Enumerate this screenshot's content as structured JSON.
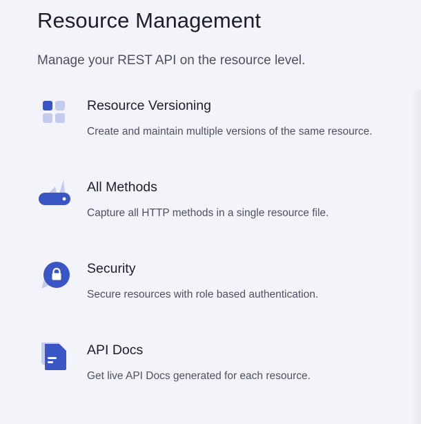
{
  "header": {
    "title": "Resource Management",
    "subtitle": "Manage your REST API on the resource level."
  },
  "colors": {
    "accent": "#3a55c4",
    "accent_light": "#c3cbee",
    "background": "#f3f4f9"
  },
  "features": [
    {
      "icon": "grid-blocks-icon",
      "title": "Resource Versioning",
      "description": "Create and maintain multiple versions of the same resource."
    },
    {
      "icon": "swiss-knife-icon",
      "title": "All Methods",
      "description": "Capture all HTTP methods in a single resource file."
    },
    {
      "icon": "lock-chat-icon",
      "title": "Security",
      "description": "Secure resources with role based authentication."
    },
    {
      "icon": "document-icon",
      "title": "API Docs",
      "description": "Get live API Docs generated for each resource."
    }
  ]
}
